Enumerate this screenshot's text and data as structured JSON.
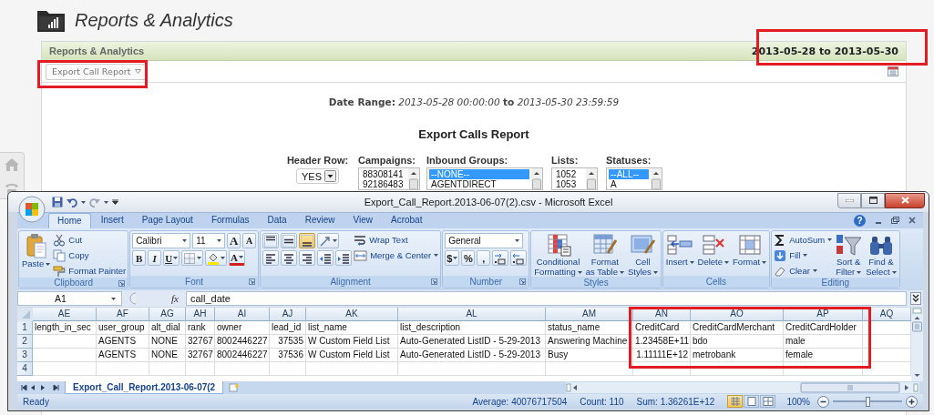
{
  "page": {
    "title": "Reports & Analytics"
  },
  "panel": {
    "title": "Reports & Analytics",
    "date_range": "2013-05-28 to 2013-05-30",
    "export_button": "Export Call Report",
    "date_range_text": "**Date Range:** *2013-05-28 00:00:00* **to** *2013-05-30 23:59:59*",
    "heading": "Export Calls Report",
    "fields": [
      {
        "kind": "select",
        "label": "Header Row:",
        "value": "YES"
      },
      {
        "kind": "listbox",
        "label": "Campaigns:",
        "options": [
          {
            "text": "88308141",
            "selected": false
          },
          {
            "text": "92186483",
            "selected": false
          }
        ]
      },
      {
        "kind": "listbox",
        "label": "Inbound Groups:",
        "options": [
          {
            "text": "--NONE--",
            "selected": true
          },
          {
            "text": "AGENTDIRECT",
            "selected": false
          }
        ]
      },
      {
        "kind": "listbox",
        "label": "Lists:",
        "options": [
          {
            "text": "1052",
            "selected": false
          },
          {
            "text": "1053",
            "selected": false
          }
        ]
      },
      {
        "kind": "listbox",
        "label": "Statuses:",
        "options": [
          {
            "text": "--ALL--",
            "selected": true
          },
          {
            "text": "A",
            "selected": false
          }
        ]
      }
    ]
  },
  "excel": {
    "title": "Export_Call_Report.2013-06-07(2).csv - Microsoft Excel",
    "tabs": [
      {
        "label": "Home",
        "selected": true
      },
      {
        "label": "Insert",
        "selected": false
      },
      {
        "label": "Page Layout",
        "selected": false
      },
      {
        "label": "Formulas",
        "selected": false
      },
      {
        "label": "Data",
        "selected": false
      },
      {
        "label": "Review",
        "selected": false
      },
      {
        "label": "View",
        "selected": false
      },
      {
        "label": "Acrobat",
        "selected": false
      }
    ],
    "help": "?",
    "ribbon": [
      {
        "name": "Clipboard",
        "launcher": true,
        "sections": [
          {
            "kind": "large",
            "label": "Paste",
            "menu": true
          },
          {
            "kind": "stack",
            "items": [
              {
                "kind": "small",
                "label": "Cut",
                "menu": false
              },
              {
                "kind": "small",
                "label": "Copy",
                "menu": false
              },
              {
                "kind": "small",
                "label": "Format Painter",
                "menu": false
              }
            ]
          }
        ]
      },
      {
        "name": "Font",
        "launcher": true,
        "sections": [
          {
            "kind": "stack",
            "items": [
              {
                "kind": "row",
                "items": [
                  {
                    "kind": "fontbox",
                    "value": "Calibri"
                  },
                  {
                    "kind": "sizebox",
                    "value": "11"
                  },
                  {
                    "kind": "grow",
                    "label": "A",
                    "menu": false
                  },
                  {
                    "kind": "shrink",
                    "label": "A",
                    "menu": false
                  }
                ]
              },
              {
                "kind": "row",
                "items": [
                  {
                    "kind": "bold",
                    "label": "B",
                    "menu": false,
                    "on": false
                  },
                  {
                    "kind": "italic",
                    "label": "I",
                    "menu": false,
                    "on": false
                  },
                  {
                    "kind": "underline",
                    "label": "U",
                    "menu": true,
                    "on": false
                  },
                  {
                    "kind": "tool",
                    "menu": true
                  },
                  {
                    "kind": "tool",
                    "menu": true
                  },
                  {
                    "kind": "fontcolor",
                    "label": "A",
                    "menu": true
                  }
                ]
              }
            ]
          }
        ]
      },
      {
        "name": "Alignment",
        "launcher": true,
        "sections": [
          {
            "kind": "stack",
            "items": [
              {
                "kind": "row",
                "items": [
                  {
                    "kind": "tool",
                    "menu": false,
                    "on": false
                  },
                  {
                    "kind": "tool",
                    "menu": false,
                    "on": false
                  },
                  {
                    "kind": "tool",
                    "menu": false,
                    "on": true
                  },
                  {
                    "kind": "tool",
                    "menu": true
                  }
                ]
              },
              {
                "kind": "row",
                "items": [
                  {
                    "kind": "tool",
                    "menu": false,
                    "on": false
                  },
                  {
                    "kind": "tool",
                    "menu": false,
                    "on": false
                  },
                  {
                    "kind": "tool",
                    "menu": false,
                    "on": false
                  },
                  {
                    "kind": "tool",
                    "menu": false
                  },
                  {
                    "kind": "tool",
                    "menu": false
                  }
                ]
              }
            ]
          },
          {
            "kind": "stack",
            "items": [
              {
                "kind": "small",
                "label": "Wrap Text",
                "menu": false
              },
              {
                "kind": "small",
                "label": "Merge & Center",
                "menu": true
              }
            ]
          }
        ]
      },
      {
        "name": "Number",
        "launcher": true,
        "sections": [
          {
            "kind": "stack",
            "items": [
              {
                "kind": "row",
                "items": [
                  {
                    "kind": "formatbox",
                    "value": "General"
                  }
                ]
              },
              {
                "kind": "row",
                "items": [
                  {
                    "kind": "symbol",
                    "label": "$",
                    "menu": true
                  },
                  {
                    "kind": "symbol",
                    "label": "%",
                    "menu": false
                  },
                  {
                    "kind": "symbol",
                    "label": ",",
                    "menu": false
                  },
                  {
                    "kind": "tool",
                    "menu": false
                  },
                  {
                    "kind": "tool",
                    "menu": false
                  }
                ]
              }
            ]
          }
        ]
      },
      {
        "name": "Styles",
        "launcher": false,
        "sections": [
          {
            "kind": "large",
            "label": "Conditional\nFormatting",
            "menu": true
          },
          {
            "kind": "large",
            "label": "Format\nas Table",
            "menu": true
          },
          {
            "kind": "large",
            "label": "Cell\nStyles",
            "menu": true
          }
        ]
      },
      {
        "name": "Cells",
        "launcher": false,
        "sections": [
          {
            "kind": "large",
            "label": "Insert",
            "menu": true
          },
          {
            "kind": "large",
            "label": "Delete",
            "menu": true
          },
          {
            "kind": "large",
            "label": "Format",
            "menu": true
          }
        ]
      },
      {
        "name": "Editing",
        "launcher": false,
        "sections": [
          {
            "kind": "stack",
            "items": [
              {
                "kind": "small",
                "label": "AutoSum",
                "menu": true
              },
              {
                "kind": "small",
                "label": "Fill",
                "menu": true
              },
              {
                "kind": "small",
                "label": "Clear",
                "menu": true
              }
            ]
          },
          {
            "kind": "large",
            "label": "Sort &\nFilter",
            "menu": true
          },
          {
            "kind": "large",
            "label": "Find &\nSelect",
            "menu": true
          }
        ]
      }
    ],
    "name_box": "A1",
    "fx": "fx",
    "formula": "call_date",
    "columns": [
      "AE",
      "AF",
      "AG",
      "AH",
      "AI",
      "AJ",
      "AK",
      "AL",
      "AM",
      "AN",
      "AO",
      "AP",
      "AQ"
    ],
    "rows": [
      {
        "header": "1",
        "cells": [
          {
            "text": "length_in_sec",
            "kind": "text"
          },
          {
            "text": "user_group",
            "kind": "text"
          },
          {
            "text": "alt_dial",
            "kind": "text"
          },
          {
            "text": "rank",
            "kind": "text"
          },
          {
            "text": "owner",
            "kind": "text"
          },
          {
            "text": "lead_id",
            "kind": "text"
          },
          {
            "text": "list_name",
            "kind": "text"
          },
          {
            "text": "list_description",
            "kind": "text"
          },
          {
            "text": "status_name",
            "kind": "text"
          },
          {
            "text": "CreditCard",
            "kind": "text"
          },
          {
            "text": "CreditCardMerchant",
            "kind": "text"
          },
          {
            "text": "CreditCardHolder",
            "kind": "text"
          },
          null
        ]
      },
      {
        "header": "2",
        "cells": [
          null,
          {
            "text": "AGENTS",
            "kind": "text"
          },
          {
            "text": "NONE",
            "kind": "text"
          },
          {
            "text": "32767",
            "kind": "number"
          },
          {
            "text": "8002446227",
            "kind": "number"
          },
          {
            "text": "37535",
            "kind": "number"
          },
          {
            "text": "W Custom Field List",
            "kind": "text"
          },
          {
            "text": "Auto-Generated ListID - 5-29-2013",
            "kind": "text"
          },
          {
            "text": "Answering Machine",
            "kind": "text"
          },
          {
            "text": "1.23458E+11",
            "kind": "number"
          },
          {
            "text": "bdo",
            "kind": "text"
          },
          {
            "text": "male",
            "kind": "text"
          },
          null
        ]
      },
      {
        "header": "3",
        "cells": [
          null,
          {
            "text": "AGENTS",
            "kind": "text"
          },
          {
            "text": "NONE",
            "kind": "text"
          },
          {
            "text": "32767",
            "kind": "number"
          },
          {
            "text": "8002446227",
            "kind": "number"
          },
          {
            "text": "37536",
            "kind": "number"
          },
          {
            "text": "W Custom Field List",
            "kind": "text"
          },
          {
            "text": "Auto-Generated ListID - 5-29-2013",
            "kind": "text"
          },
          {
            "text": "Busy",
            "kind": "text"
          },
          {
            "text": "1.11111E+12",
            "kind": "number"
          },
          {
            "text": "metrobank",
            "kind": "text"
          },
          {
            "text": "female",
            "kind": "text"
          },
          null
        ]
      },
      {
        "header": "4"
      }
    ],
    "sheet_tab": {
      "label": "Export_Call_Report.2013-06-07(2",
      "selected": true
    },
    "status": {
      "mode": "Ready",
      "stats": [
        "Average: 40076717504",
        "Count: 110",
        "Sum: 1.36261E+12"
      ],
      "views": [
        {
          "selected": true
        },
        {
          "selected": false
        },
        {
          "selected": false
        }
      ],
      "zoom": "100%",
      "zoom_slider": {
        "level": 0.5
      }
    }
  }
}
